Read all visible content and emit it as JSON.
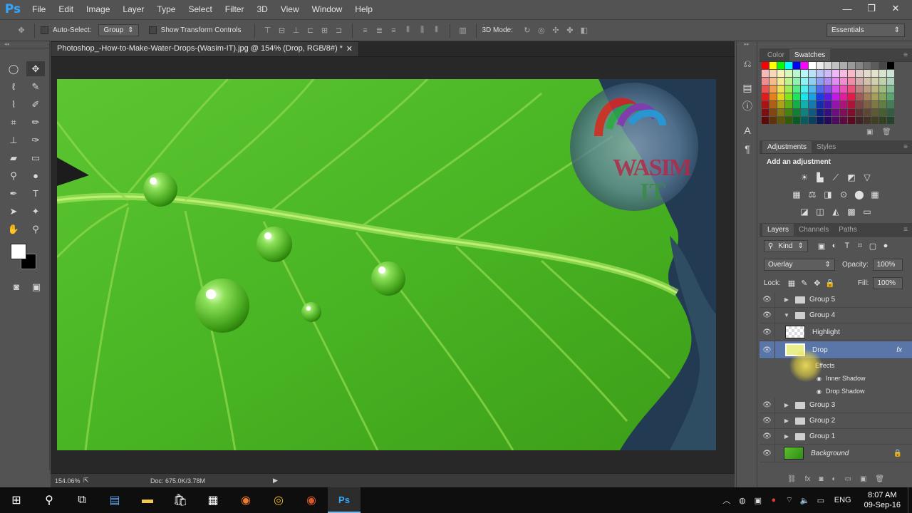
{
  "app": {
    "logo": "Ps",
    "menu": [
      "File",
      "Edit",
      "Image",
      "Layer",
      "Type",
      "Select",
      "Filter",
      "3D",
      "View",
      "Window",
      "Help"
    ],
    "window_controls": [
      "—",
      "❐",
      "✕"
    ]
  },
  "options": {
    "auto_select_label": "Auto-Select:",
    "auto_select_value": "Group",
    "transform_label": "Show Transform Controls",
    "mode_3d_label": "3D Mode:",
    "workspace": "Essentials"
  },
  "document": {
    "tab_title": "Photoshop_-How-to-Make-Water-Drops-(Wasim-IT).jpg @ 154% (Drop, RGB/8#) *",
    "tab_close": "✕",
    "zoom": "154.06%",
    "doc_info": "Doc: 675.0K/3.78M",
    "watermark_line1": "WASIM",
    "watermark_line2": "IT"
  },
  "panels": {
    "color_tabs": [
      "Color",
      "Swatches"
    ],
    "adjust_tabs": [
      "Adjustments",
      "Styles"
    ],
    "adjust_title": "Add an adjustment",
    "layers_tabs": [
      "Layers",
      "Channels",
      "Paths"
    ],
    "kind_label": "Kind",
    "blend_mode": "Overlay",
    "opacity_label": "Opacity:",
    "opacity_value": "100%",
    "lock_label": "Lock:",
    "fill_label": "Fill:",
    "fill_value": "100%"
  },
  "layers": {
    "group5": "Group 5",
    "group4": "Group 4",
    "highlight": "Highlight",
    "drop": "Drop",
    "effects": "Effects",
    "inner_shadow": "Inner Shadow",
    "drop_shadow": "Drop Shadow",
    "group3": "Group 3",
    "group2": "Group 2",
    "group1": "Group 1",
    "background": "Background",
    "fx": "fx"
  },
  "taskbar": {
    "language": "ENG",
    "time": "8:07 AM",
    "date": "09-Sep-16"
  },
  "swatch_colors": [
    "#ff0000",
    "#ffff00",
    "#00ff00",
    "#00ffff",
    "#0000ff",
    "#ff00ff",
    "#ffffff",
    "#ebebeb",
    "#d6d6d6",
    "#c2c2c2",
    "#adadad",
    "#999999",
    "#858585",
    "#707070",
    "#5c5c5c",
    "#474747",
    "#000000"
  ]
}
